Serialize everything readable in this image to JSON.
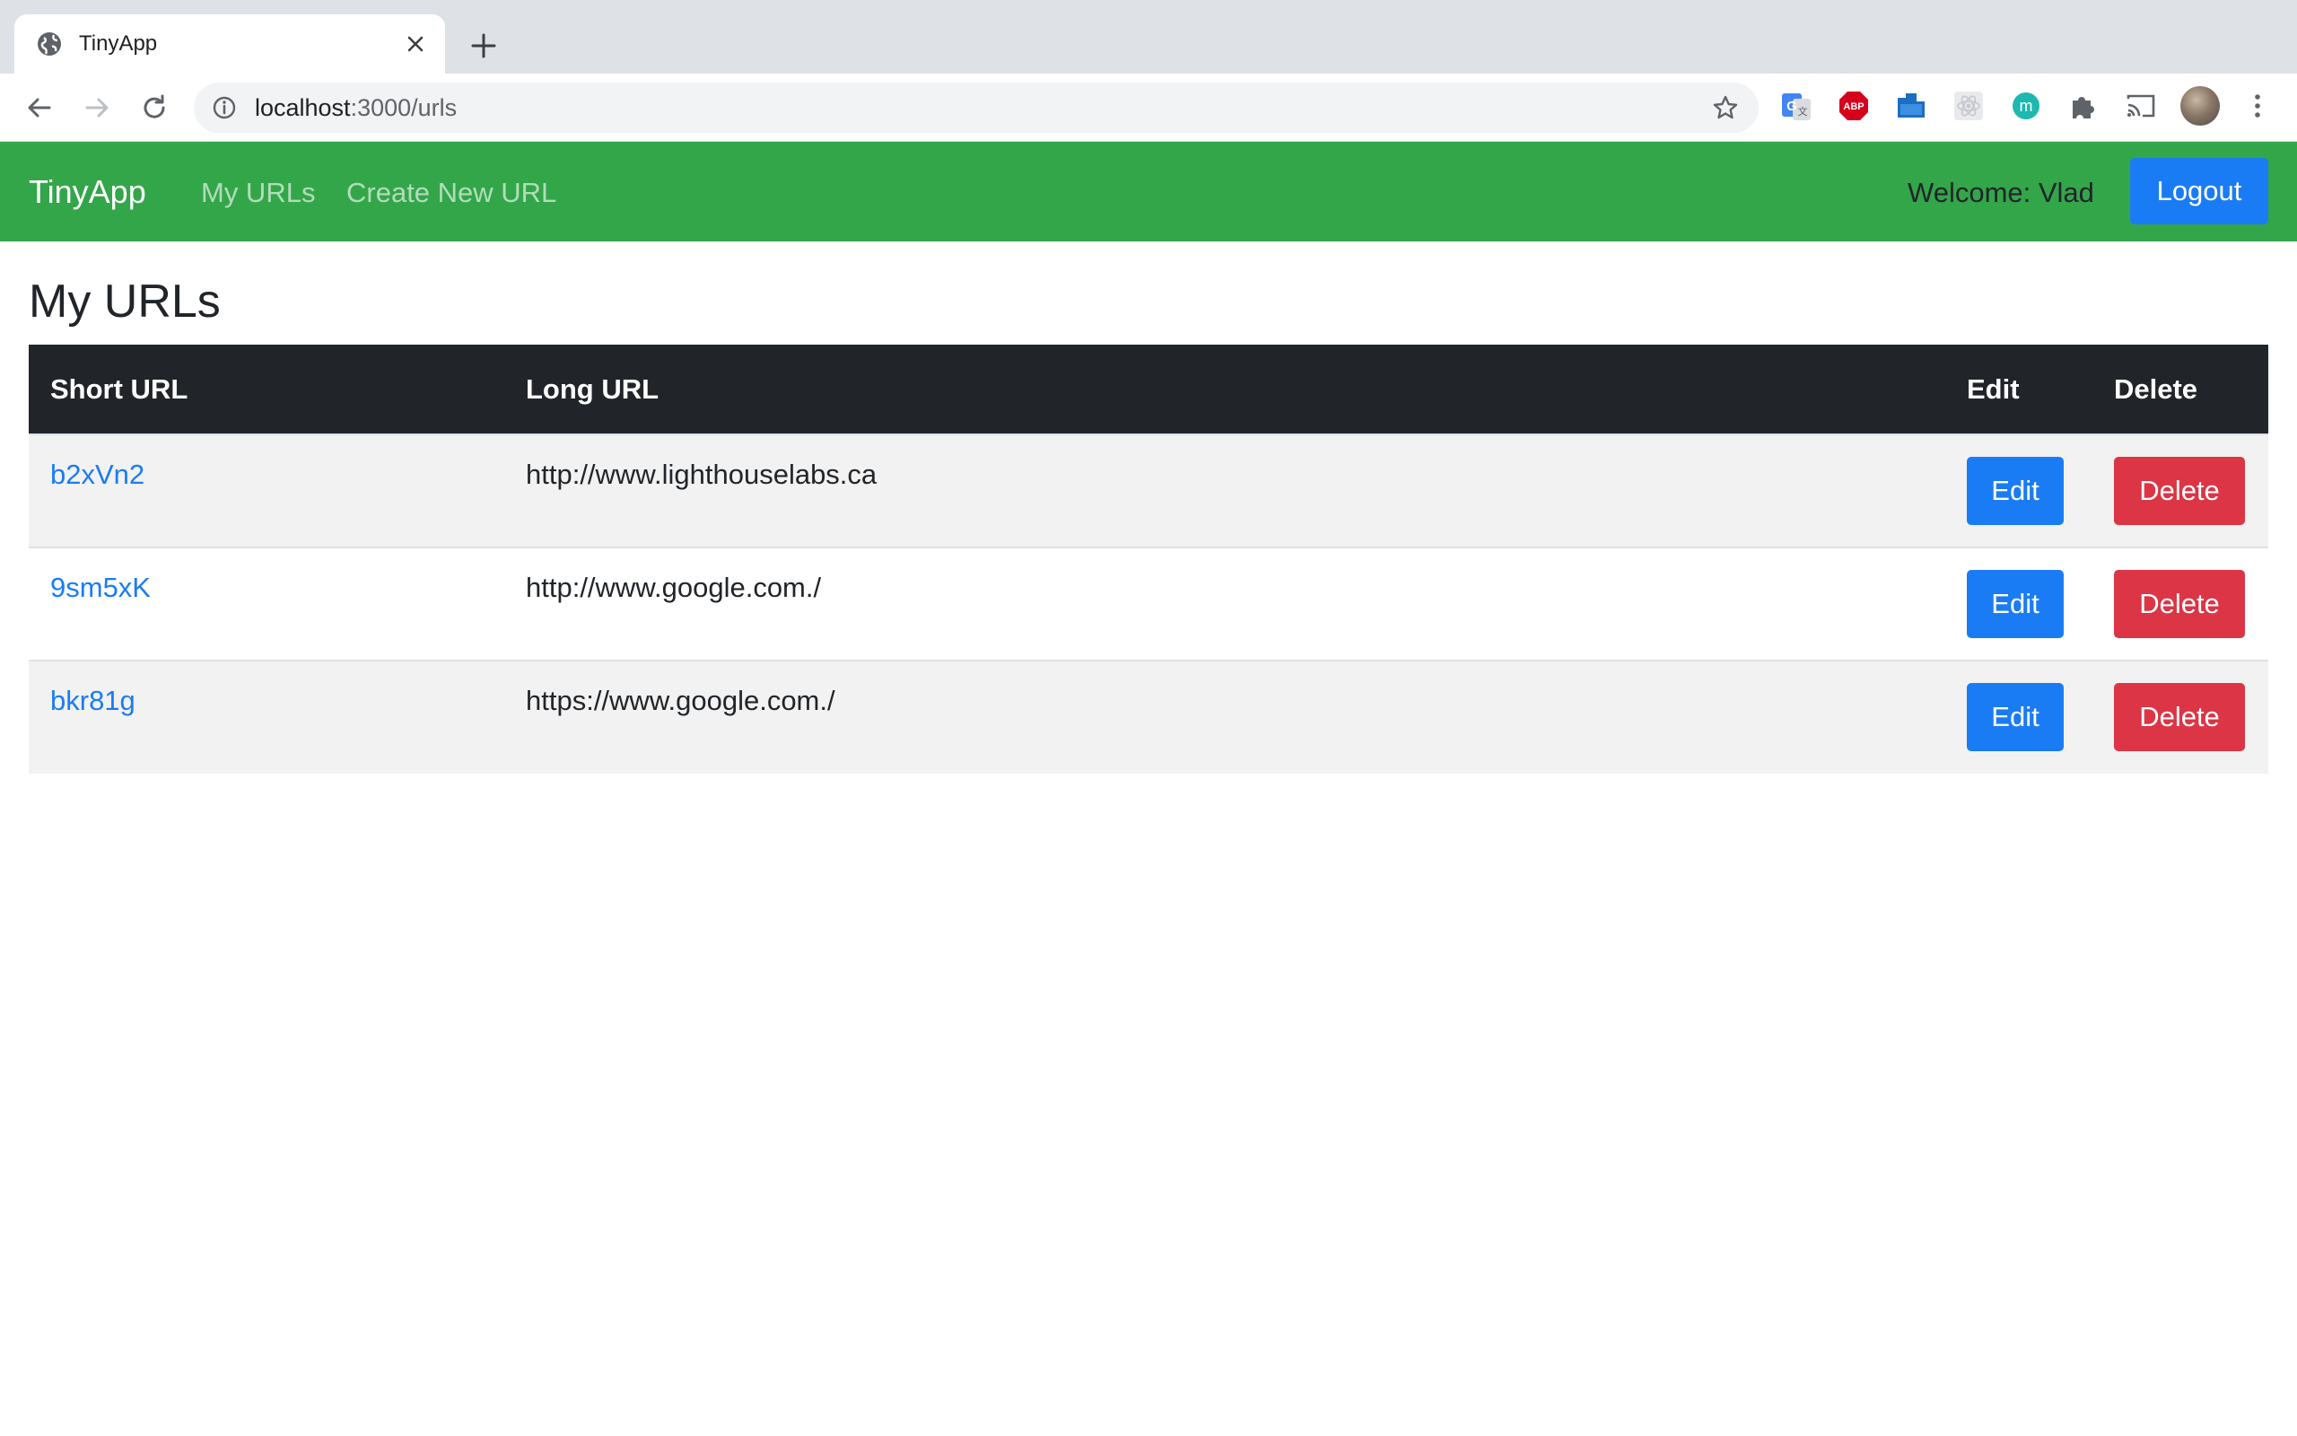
{
  "browser": {
    "tab_title": "TinyApp",
    "url_host": "localhost",
    "url_path": ":3000/urls",
    "extensions": [
      "google-translate-icon",
      "adblock-plus-icon",
      "folder-extension-icon",
      "react-devtools-icon",
      "m-extension-icon",
      "puzzle-icon",
      "cast-icon"
    ]
  },
  "navbar": {
    "brand": "TinyApp",
    "links": [
      "My URLs",
      "Create New URL"
    ],
    "welcome": "Welcome: Vlad",
    "logout_label": "Logout",
    "color": "#33a64a"
  },
  "main": {
    "title": "My URLs",
    "columns": [
      "Short URL",
      "Long URL",
      "Edit",
      "Delete"
    ],
    "rows": [
      {
        "short_url": "b2xVn2",
        "long_url": "http://www.lighthouselabs.ca",
        "edit_label": "Edit",
        "delete_label": "Delete"
      },
      {
        "short_url": "9sm5xK",
        "long_url": "http://www.google.com./",
        "edit_label": "Edit",
        "delete_label": "Delete"
      },
      {
        "short_url": "bkr81g",
        "long_url": "https://www.google.com./",
        "edit_label": "Edit",
        "delete_label": "Delete"
      }
    ]
  },
  "colors": {
    "primary": "#1a7cf5",
    "danger": "#dc3545",
    "table_header": "#212529"
  }
}
